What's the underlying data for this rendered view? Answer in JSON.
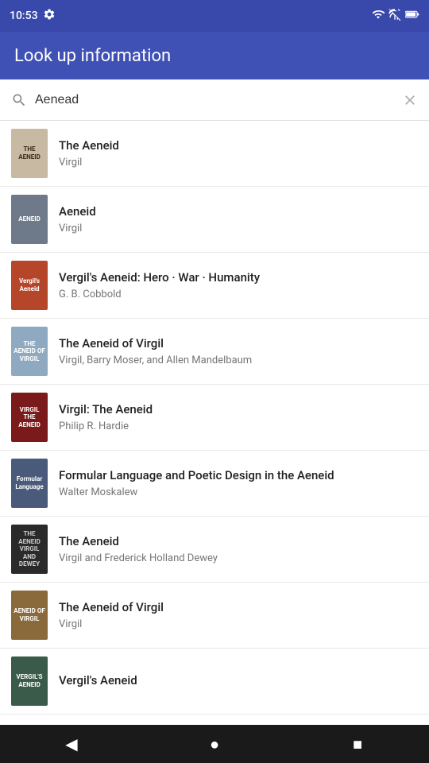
{
  "statusBar": {
    "time": "10:53",
    "icons": [
      "settings",
      "wifi",
      "signal",
      "battery"
    ]
  },
  "header": {
    "title": "Look up information"
  },
  "searchBar": {
    "query": "Aenead",
    "placeholder": "Search"
  },
  "results": [
    {
      "id": 1,
      "title": "The Aeneid",
      "author": "Virgil",
      "coverClass": "cover-1",
      "coverText": "THE AENEID"
    },
    {
      "id": 2,
      "title": "Aeneid",
      "author": "Virgil",
      "coverClass": "cover-2",
      "coverText": "AENEID"
    },
    {
      "id": 3,
      "title": "Vergil's Aeneid: Hero · War · Humanity",
      "author": "G. B. Cobbold",
      "coverClass": "cover-3",
      "coverText": "Vergil's Aeneid"
    },
    {
      "id": 4,
      "title": "The Aeneid of Virgil",
      "author": "Virgil, Barry Moser, and Allen Mandelbaum",
      "coverClass": "cover-4",
      "coverText": "THE AENEID OF VIRGIL"
    },
    {
      "id": 5,
      "title": "Virgil: The Aeneid",
      "author": "Philip R. Hardie",
      "coverClass": "cover-5",
      "coverText": "VIRGIL THE AENEID"
    },
    {
      "id": 6,
      "title": "Formular Language and Poetic Design in the Aeneid",
      "author": "Walter Moskalew",
      "coverClass": "cover-6",
      "coverText": "Formular Language"
    },
    {
      "id": 7,
      "title": "The Aeneid",
      "author": "Virgil and Frederick Holland Dewey",
      "coverClass": "cover-7",
      "coverText": "THE AENEID VIRGIL AND DEWEY"
    },
    {
      "id": 8,
      "title": "The Aeneid of Virgil",
      "author": "Virgil",
      "coverClass": "cover-8",
      "coverText": "AENEID OF VIRGIL"
    },
    {
      "id": 9,
      "title": "Vergil's Aeneid",
      "author": "",
      "coverClass": "cover-9",
      "coverText": "VERGIL'S AENEID"
    }
  ],
  "navBar": {
    "back": "◀",
    "home": "●",
    "recent": "■"
  }
}
